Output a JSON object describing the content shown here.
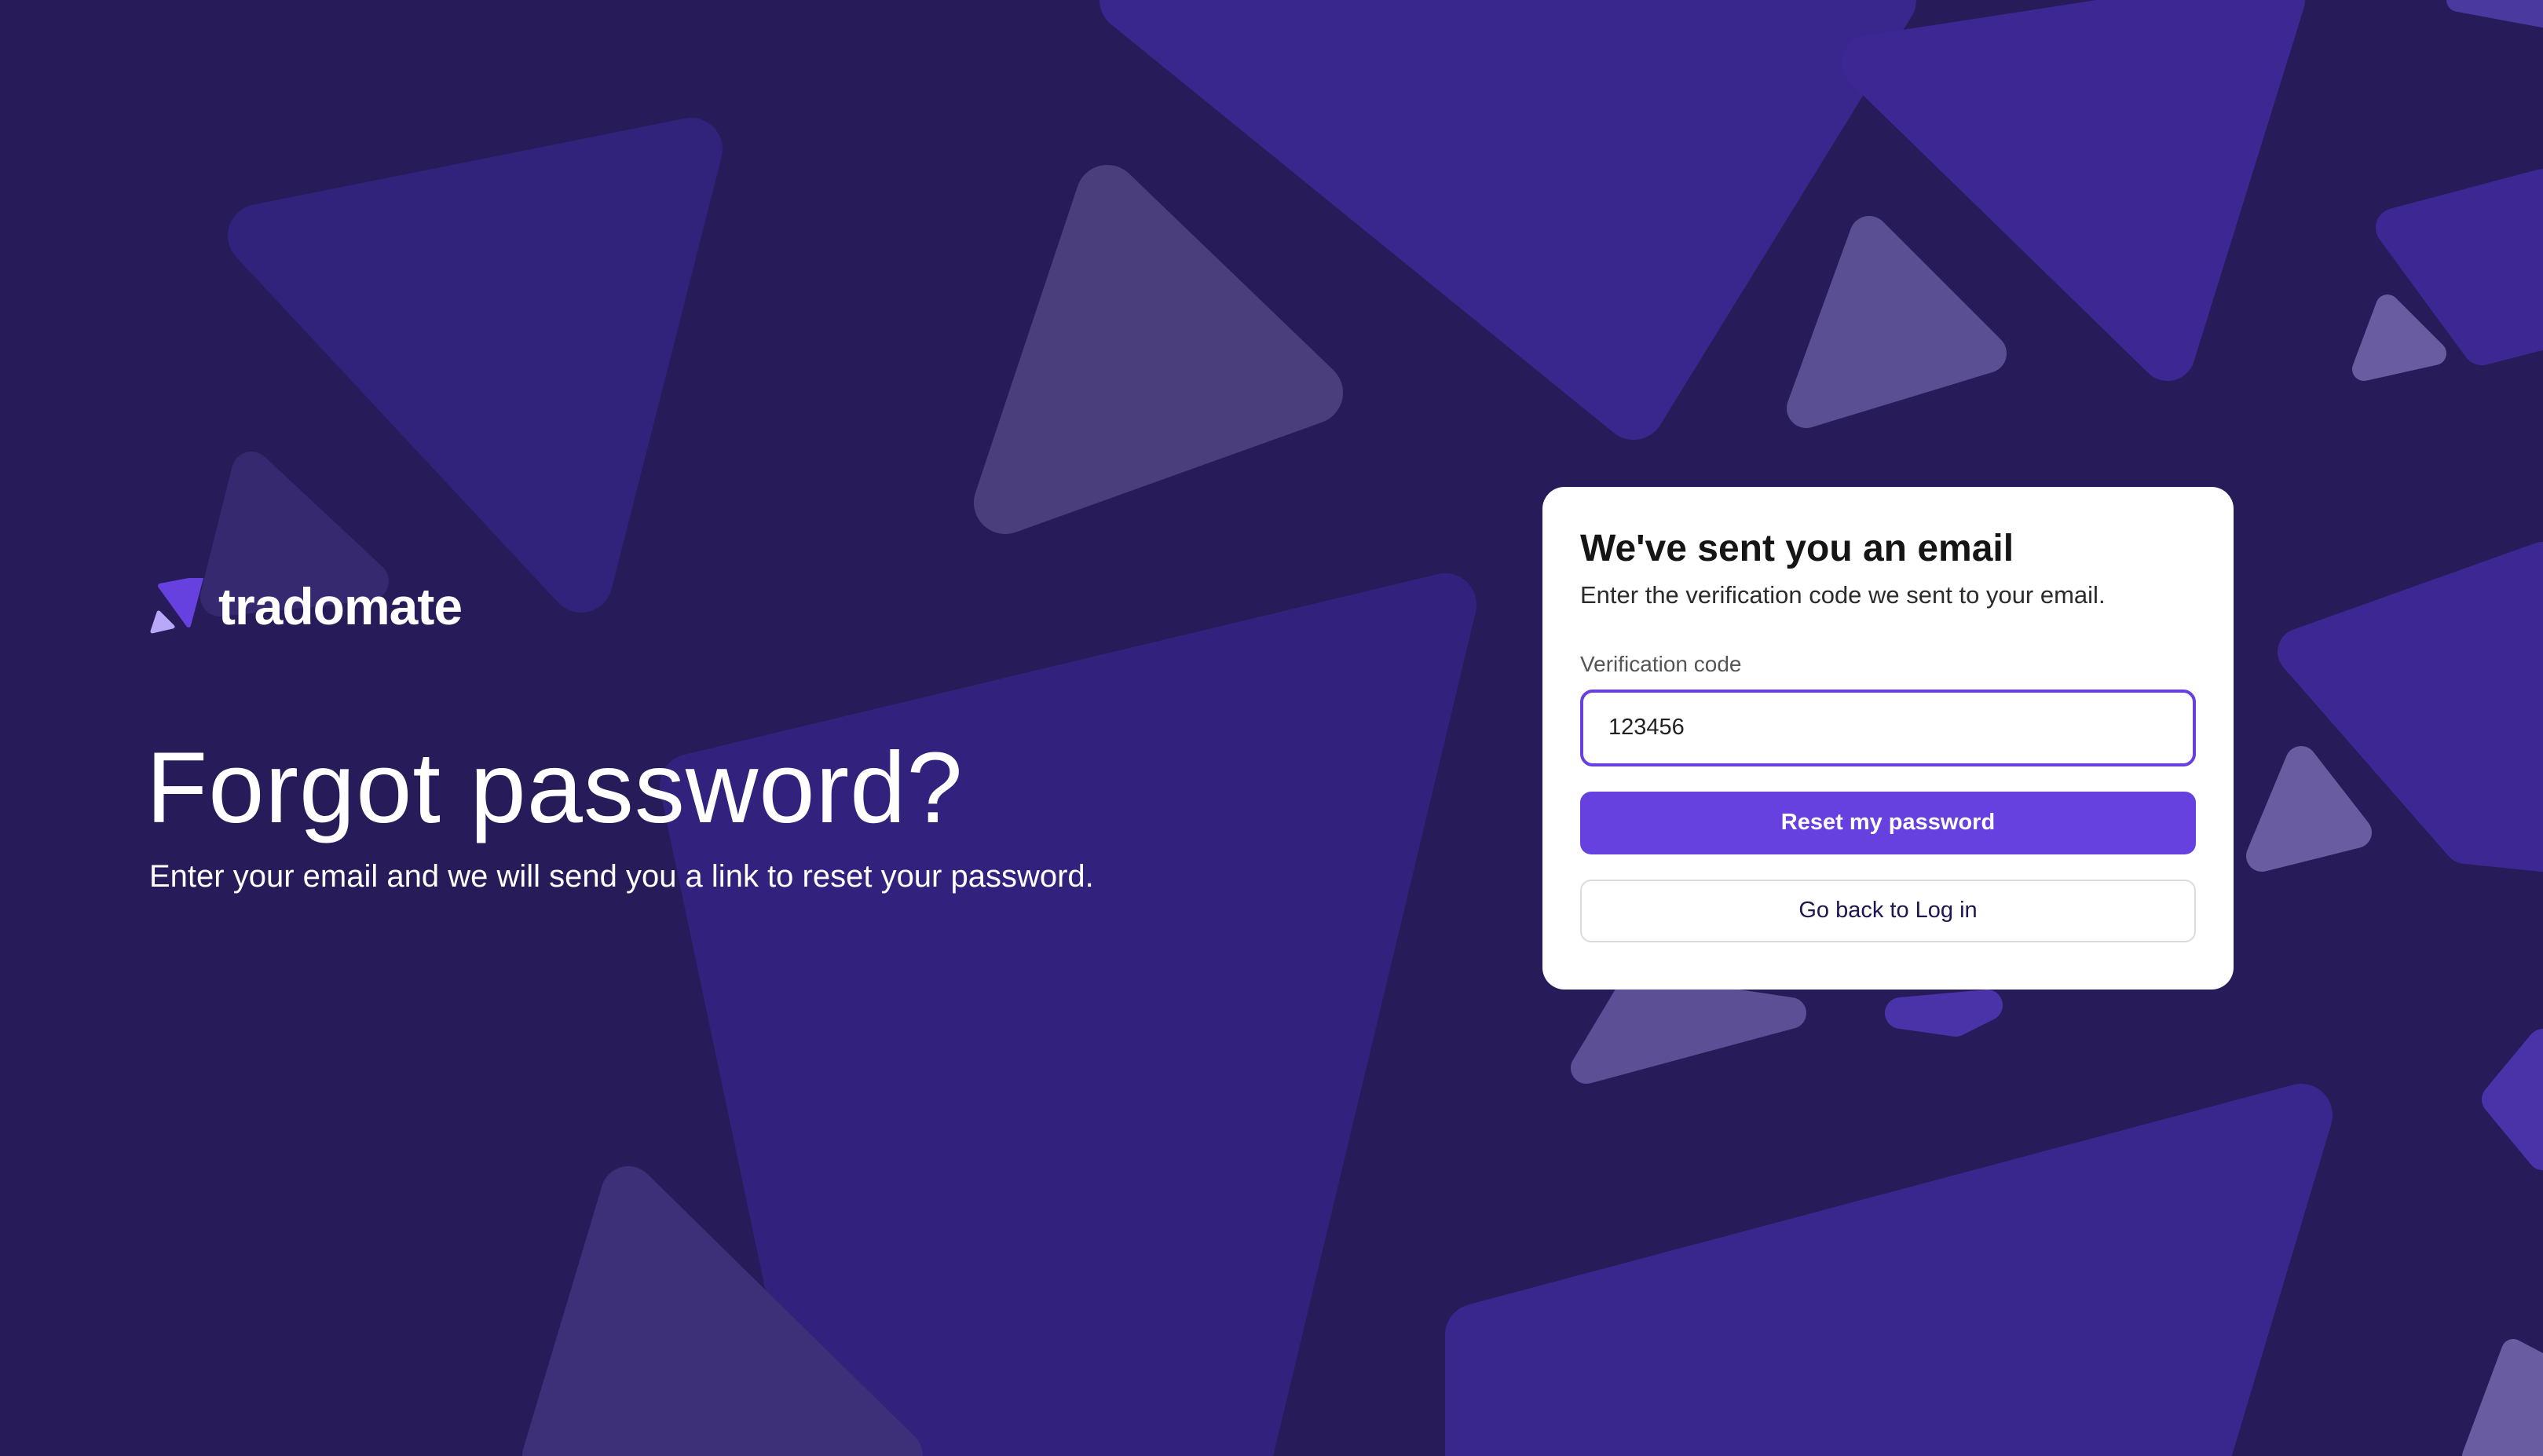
{
  "brand": {
    "name": "tradomate",
    "accent": "#6741e0",
    "background": "#281b59"
  },
  "hero": {
    "title": "Forgot password?",
    "subtitle": "Enter your email and we will send you a link to reset your password."
  },
  "card": {
    "title": "We've sent you an email",
    "subtitle": "Enter the verification code we sent to your email.",
    "field_label": "Verification code",
    "code_value": "123456",
    "primary_button": "Reset my password",
    "secondary_button": "Go back to Log in"
  }
}
